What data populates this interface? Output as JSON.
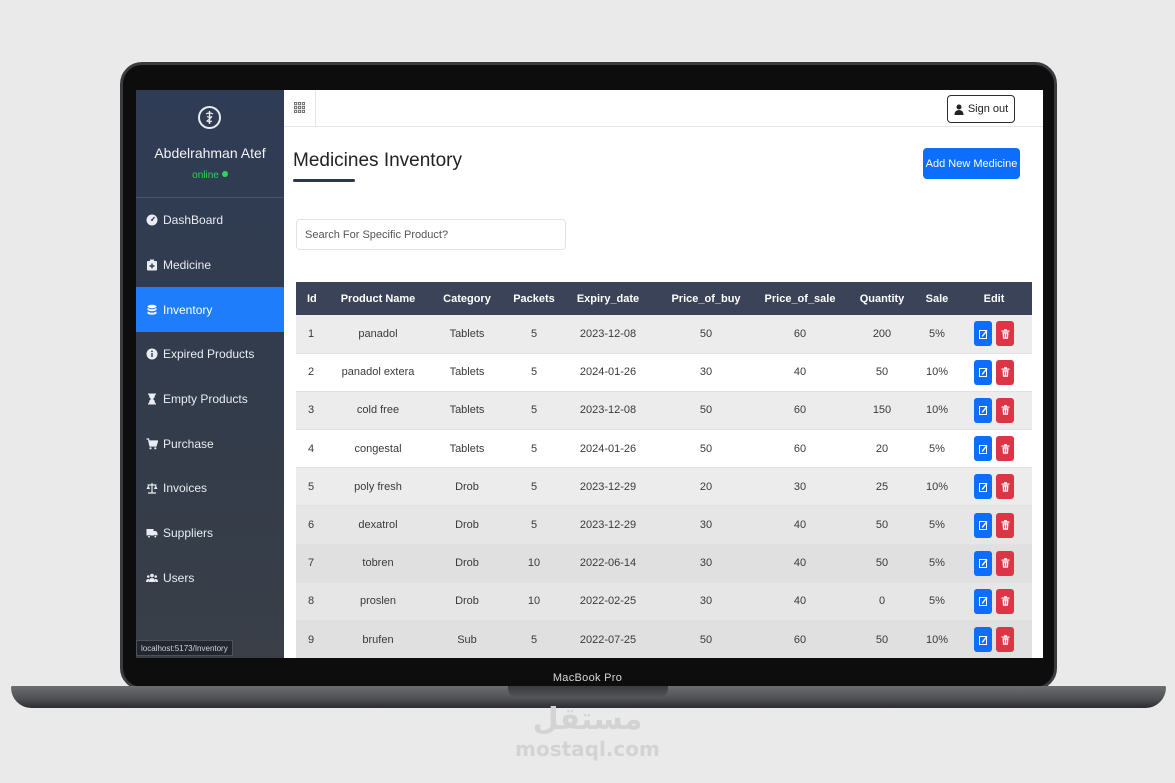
{
  "device": {
    "bezel_label": "MacBook Pro"
  },
  "watermark": {
    "arabic": "مستقل",
    "latin": "mostaql.com"
  },
  "sidebar": {
    "user_name": "Abdelrahman Atef",
    "status": "online",
    "items": [
      {
        "label": "DashBoard",
        "icon": "dashboard-icon",
        "active": false
      },
      {
        "label": "Medicine",
        "icon": "medicine-icon",
        "active": false
      },
      {
        "label": "Inventory",
        "icon": "database-icon",
        "active": true
      },
      {
        "label": "Expired Products",
        "icon": "info-circle-icon",
        "active": false
      },
      {
        "label": "Empty Products",
        "icon": "hourglass-icon",
        "active": false
      },
      {
        "label": "Purchase",
        "icon": "cart-icon",
        "active": false
      },
      {
        "label": "Invoices",
        "icon": "scale-icon",
        "active": false
      },
      {
        "label": "Suppliers",
        "icon": "truck-icon",
        "active": false
      },
      {
        "label": "Users",
        "icon": "users-icon",
        "active": false
      }
    ],
    "status_url": "localhost:5173/Inventory"
  },
  "topbar": {
    "signout_label": "Sign out"
  },
  "main": {
    "title": "Medicines Inventory",
    "add_button_label": "Add New Medicine",
    "search_placeholder": "Search For Specific Product?"
  },
  "table": {
    "columns": [
      "Id",
      "Product Name",
      "Category",
      "Packets",
      "Expiry_date",
      "Price_of_buy",
      "Price_of_sale",
      "Quantity",
      "Sale",
      "Edit"
    ],
    "rows": [
      [
        "1",
        "panadol",
        "Tablets",
        "5",
        "2023-12-08",
        "50",
        "60",
        "200",
        "5%"
      ],
      [
        "2",
        "panadol extera",
        "Tablets",
        "5",
        "2024-01-26",
        "30",
        "40",
        "50",
        "10%"
      ],
      [
        "3",
        "cold free",
        "Tablets",
        "5",
        "2023-12-08",
        "50",
        "60",
        "150",
        "10%"
      ],
      [
        "4",
        "congestal",
        "Tablets",
        "5",
        "2024-01-26",
        "50",
        "60",
        "20",
        "5%"
      ],
      [
        "5",
        "poly fresh",
        "Drob",
        "5",
        "2023-12-29",
        "20",
        "30",
        "25",
        "10%"
      ],
      [
        "6",
        "dexatrol",
        "Drob",
        "5",
        "2023-12-29",
        "30",
        "40",
        "50",
        "5%"
      ],
      [
        "7",
        "tobren",
        "Drob",
        "10",
        "2022-06-14",
        "30",
        "40",
        "50",
        "5%"
      ],
      [
        "8",
        "proslen",
        "Drob",
        "10",
        "2022-02-25",
        "30",
        "40",
        "0",
        "5%"
      ],
      [
        "9",
        "brufen",
        "Sub",
        "5",
        "2022-07-25",
        "50",
        "60",
        "50",
        "10%"
      ]
    ]
  },
  "colors": {
    "sidebar_bg": "#2f3c55",
    "active_nav": "#1d7dfa",
    "primary": "#0d6efd",
    "danger": "#dc3545",
    "table_header": "#3a4357",
    "online": "#2fd35a"
  }
}
